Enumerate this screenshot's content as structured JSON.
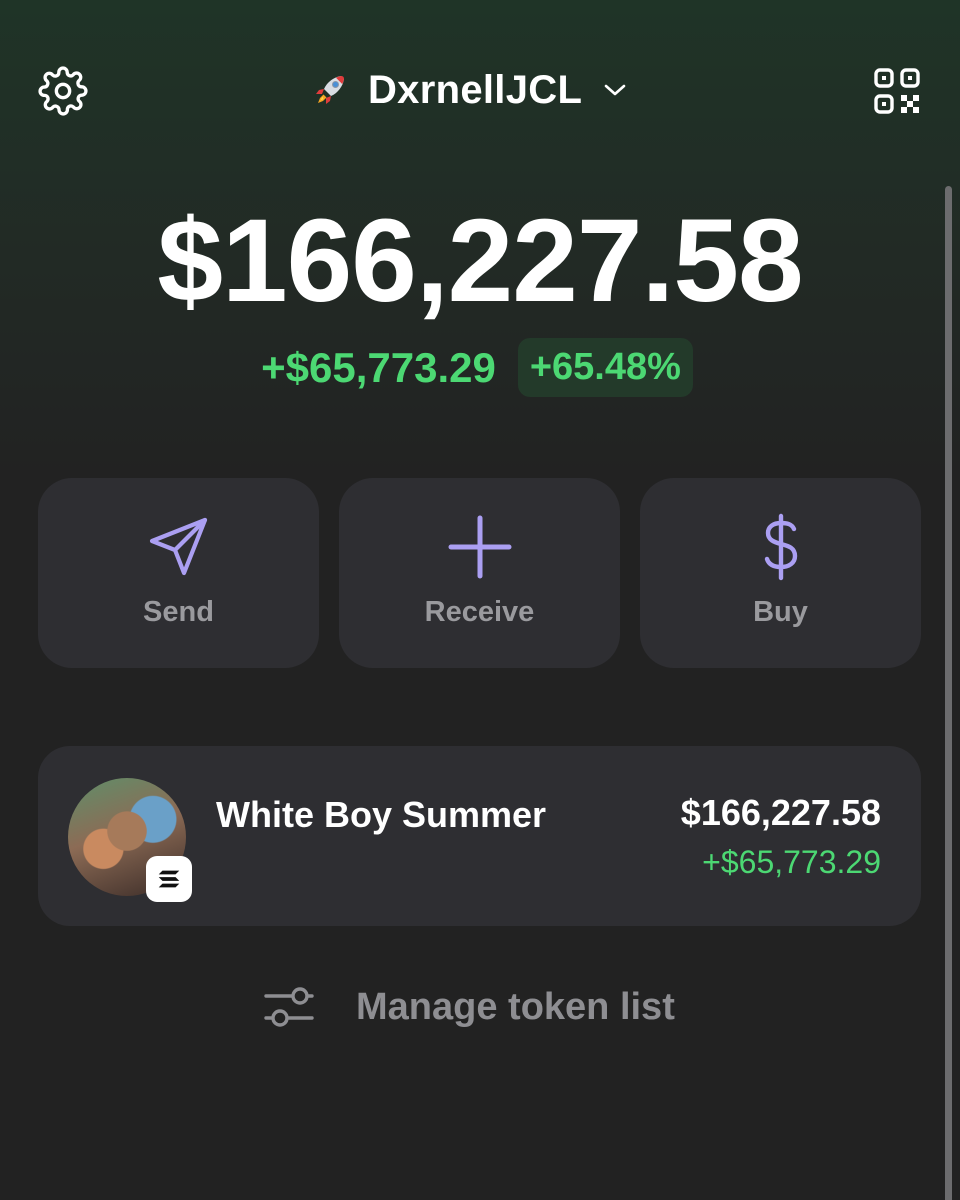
{
  "header": {
    "account_name": "DxrnellJCL",
    "account_icon": "rocket-icon",
    "settings_icon": "gear-icon",
    "qr_icon": "qr-code-icon"
  },
  "balance": {
    "total": "$166,227.58",
    "change_amount": "+$65,773.29",
    "change_percent": "+65.48%"
  },
  "actions": [
    {
      "label": "Send",
      "icon": "send-icon"
    },
    {
      "label": "Receive",
      "icon": "plus-icon"
    },
    {
      "label": "Buy",
      "icon": "dollar-icon"
    }
  ],
  "tokens": [
    {
      "name": "White Boy Summer",
      "value": "$166,227.58",
      "change": "+$65,773.29"
    }
  ],
  "manage": {
    "label": "Manage token list",
    "icon": "sliders-icon"
  },
  "colors": {
    "accent": "#ab9ff2",
    "positive": "#4cd873",
    "card": "#2e2e32",
    "background": "#222222"
  }
}
